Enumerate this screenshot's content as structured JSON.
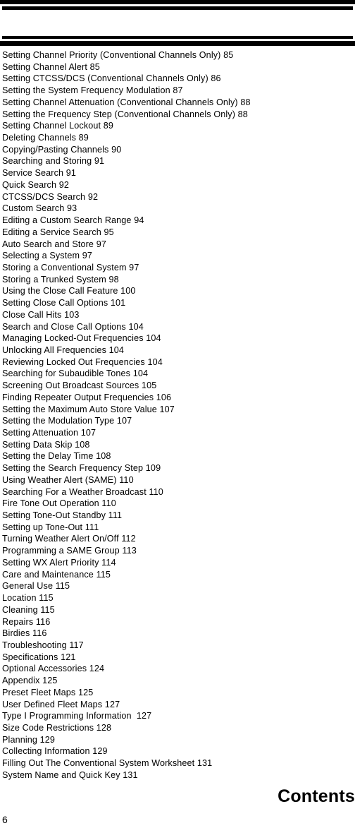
{
  "document": {
    "section_label": "Contents",
    "page_number": "6"
  },
  "header": {
    "rules": [
      "top-thick-rule",
      "top-thin-rule",
      "bottom-thin-rule",
      "bottom-thick-rule"
    ]
  },
  "toc": {
    "entries": [
      "Setting Channel Priority (Conventional Channels Only) 85",
      "Setting Channel Alert 85",
      "Setting CTCSS/DCS (Conventional Channels Only) 86",
      "Setting the System Frequency Modulation 87",
      "Setting Channel Attenuation (Conventional Channels Only) 88",
      "Setting the Frequency Step (Conventional Channels Only) 88",
      "Setting Channel Lockout 89",
      "Deleting Channels 89",
      "Copying/Pasting Channels 90",
      "Searching and Storing 91",
      "Service Search 91",
      "Quick Search 92",
      "CTCSS/DCS Search 92",
      "Custom Search 93",
      "Editing a Custom Search Range 94",
      "Editing a Service Search 95",
      "Auto Search and Store 97",
      "Selecting a System 97",
      "Storing a Conventional System 97",
      "Storing a Trunked System 98",
      "Using the Close Call Feature 100",
      "Setting Close Call Options 101",
      "Close Call Hits 103",
      "Search and Close Call Options 104",
      "Managing Locked-Out Frequencies 104",
      "Unlocking All Frequencies 104",
      "Reviewing Locked Out Frequencies 104",
      "Searching for Subaudible Tones 104",
      "Screening Out Broadcast Sources 105",
      "Finding Repeater Output Frequencies 106",
      "Setting the Maximum Auto Store Value 107",
      "Setting the Modulation Type 107",
      "Setting Attenuation 107",
      "Setting Data Skip 108",
      "Setting the Delay Time 108",
      "Setting the Search Frequency Step 109",
      "Using Weather Alert (SAME) 110",
      "Searching For a Weather Broadcast 110",
      "Fire Tone Out Operation 110",
      "Setting Tone-Out Standby 111",
      "Setting up Tone-Out 111",
      "Turning Weather Alert On/Off 112",
      "Programming a SAME Group 113",
      "Setting WX Alert Priority 114",
      "Care and Maintenance 115",
      "General Use 115",
      "Location 115",
      "Cleaning 115",
      "Repairs 116",
      "Birdies 116",
      "Troubleshooting 117",
      "Specifications 121",
      "Optional Accessories 124",
      "Appendix 125",
      "Preset Fleet Maps 125",
      "User Defined Fleet Maps 127",
      "Type I Programming Information  127",
      "Size Code Restrictions 128",
      "Planning 129",
      "Collecting Information 129",
      "Filling Out The Conventional System Worksheet 131",
      "System Name and Quick Key 131"
    ]
  }
}
